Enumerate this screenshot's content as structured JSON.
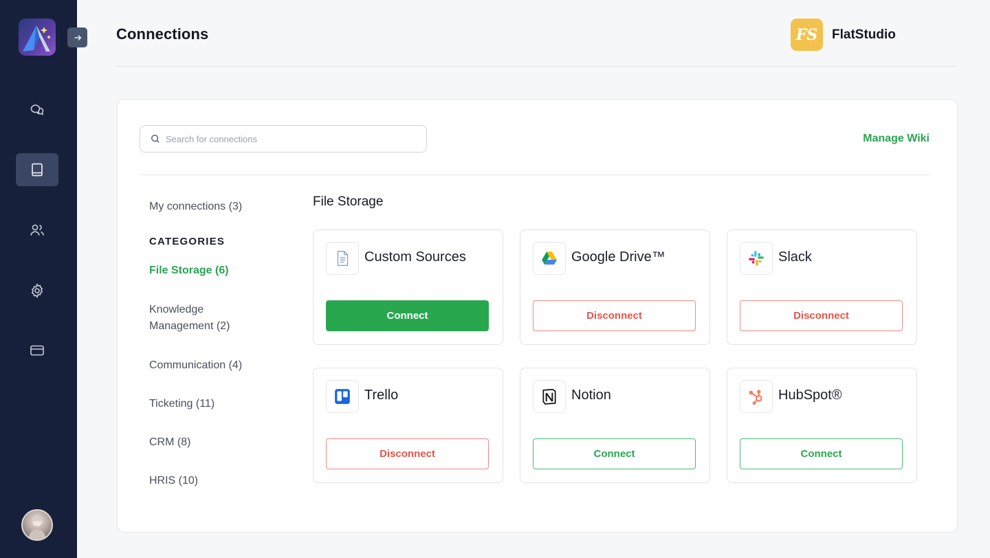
{
  "page": {
    "title": "Connections",
    "brand": {
      "mark": "FS",
      "name": "FlatStudio",
      "color": "#f3c24c"
    }
  },
  "sidebar": {
    "items": [
      {
        "name": "chat",
        "icon": "chat-bubbles-icon",
        "active": false
      },
      {
        "name": "wiki",
        "icon": "book-icon",
        "active": true
      },
      {
        "name": "users",
        "icon": "users-icon",
        "active": false
      },
      {
        "name": "settings",
        "icon": "gear-icon",
        "active": false
      },
      {
        "name": "billing",
        "icon": "credit-card-icon",
        "active": false
      }
    ],
    "expand_icon": "arrow-right-icon"
  },
  "panel": {
    "search_placeholder": "Search for connections",
    "manage_wiki": "Manage Wiki",
    "my_connections": "My connections (3)",
    "categories_heading": "CATEGORIES",
    "categories": [
      {
        "label": "File Storage (6)",
        "selected": true
      },
      {
        "label": "Knowledge Management (2)",
        "selected": false
      },
      {
        "label": "Communication (4)",
        "selected": false
      },
      {
        "label": "Ticketing (11)",
        "selected": false
      },
      {
        "label": "CRM (8)",
        "selected": false
      },
      {
        "label": "HRIS (10)",
        "selected": false
      }
    ],
    "section_title": "File Storage",
    "cards": [
      {
        "name": "Custom Sources",
        "icon": "document-icon",
        "action": "Connect",
        "style": "solid"
      },
      {
        "name": "Google Drive™",
        "icon": "google-drive-icon",
        "action": "Disconnect",
        "style": "outline-red"
      },
      {
        "name": "Slack",
        "icon": "slack-icon",
        "action": "Disconnect",
        "style": "outline-red"
      },
      {
        "name": "Trello",
        "icon": "trello-icon",
        "action": "Disconnect",
        "style": "outline-red"
      },
      {
        "name": "Notion",
        "icon": "notion-icon",
        "action": "Connect",
        "style": "outline-green"
      },
      {
        "name": "HubSpot®",
        "icon": "hubspot-icon",
        "action": "Connect",
        "style": "outline-green"
      }
    ]
  },
  "colors": {
    "sidebar": "#17203a",
    "accent_green": "#28a74f",
    "danger_red": "#e6544a"
  }
}
